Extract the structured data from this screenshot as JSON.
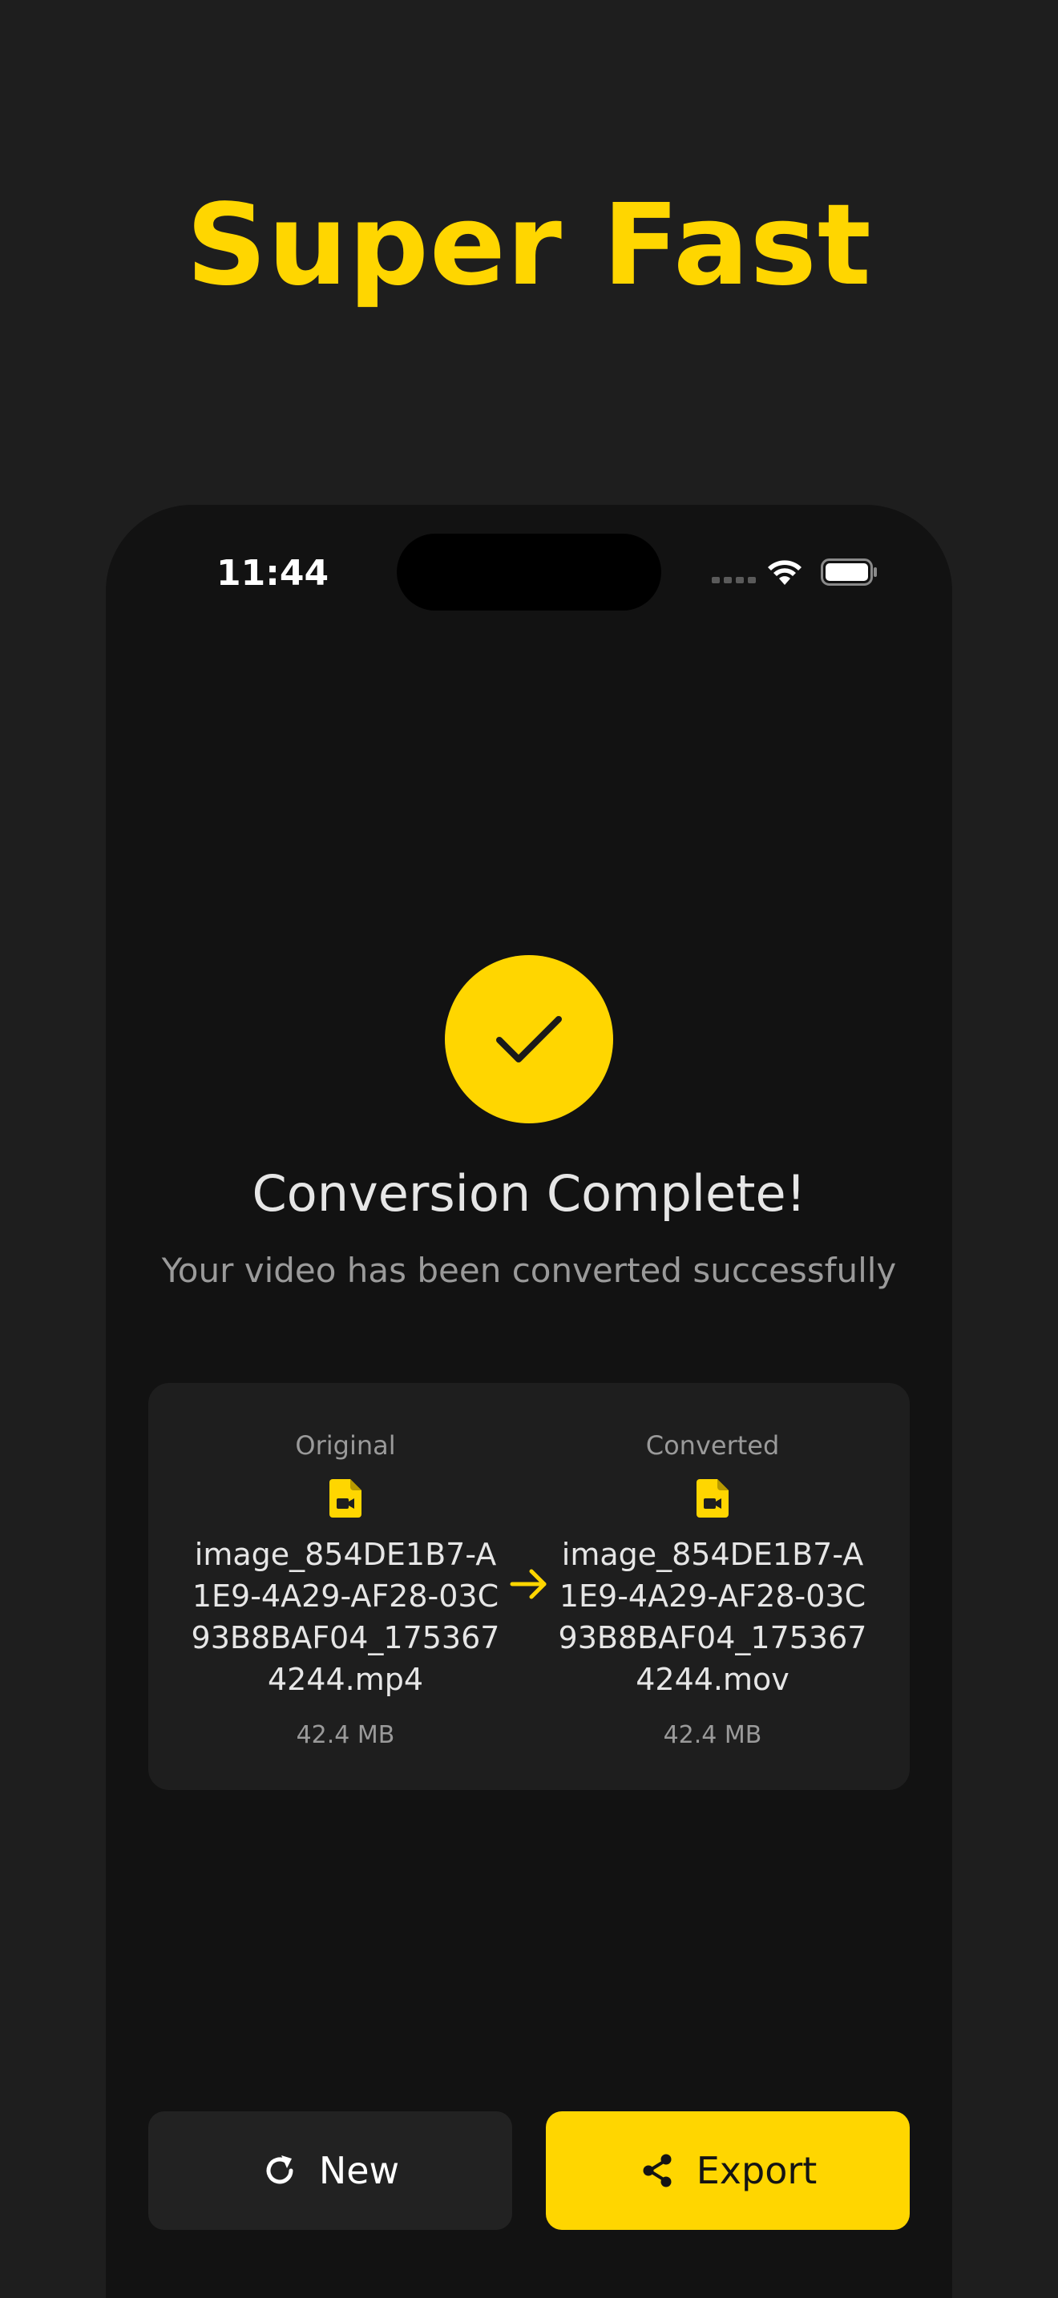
{
  "headline": "Super Fast",
  "status_bar": {
    "time": "11:44"
  },
  "icons": {
    "success": "check-icon",
    "file": "video-file-icon",
    "arrow": "arrow-right-icon",
    "new": "refresh-icon",
    "export": "share-icon"
  },
  "colors": {
    "accent": "#FFD600",
    "background": "#1e1e1e",
    "phone_screen": "#121212",
    "card": "#1e1e1e"
  },
  "result": {
    "title": "Conversion Complete!",
    "subtitle": "Your video has been converted successfully"
  },
  "files": {
    "original": {
      "label": "Original",
      "name": "image_854DE1B7-A1E9-4A29-AF28-03C93B8BAF04_1753674244.mp4",
      "size": "42.4 MB"
    },
    "converted": {
      "label": "Converted",
      "name": "image_854DE1B7-A1E9-4A29-AF28-03C93B8BAF04_1753674244.mov",
      "size": "42.4 MB"
    }
  },
  "actions": {
    "new_label": "New",
    "export_label": "Export"
  }
}
